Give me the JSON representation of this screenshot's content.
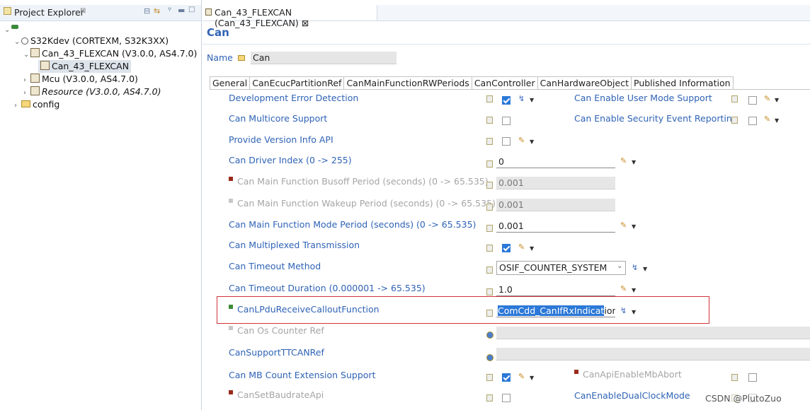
{
  "explorer": {
    "title": "Project Explorer",
    "title_suffix": "⊠",
    "tree": {
      "root": "",
      "project": "S32Kdev (CORTEXM, S32K3XX)",
      "module1": "Can_43_FLEXCAN (V3.0.0, AS4.7.0)",
      "module1_child": "Can_43_FLEXCAN",
      "module2": "Mcu (V3.0.0, AS4.7.0)",
      "module3": "Resource (V3.0.0, AS4.7.0)",
      "folder": "config"
    }
  },
  "editor": {
    "tab_title": "Can_43_FLEXCAN (Can_43_FLEXCAN) ⊠",
    "header": "Can",
    "name_label": "Name",
    "name_value": "Can",
    "tabs": [
      "General",
      "CanEcucPartitionRef",
      "CanMainFunctionRWPeriods",
      "CanController",
      "CanHardwareObject",
      "Published Information"
    ]
  },
  "params": {
    "dev_error": "Development Error Detection",
    "multicore": "Can Multicore Support",
    "version_info": "Provide Version Info API",
    "driver_index": "Can Driver Index (0 -> 255)",
    "driver_index_val": "0",
    "busoff": "Can Main Function Busoff Period (seconds) (0 -> 65.535)",
    "busoff_val": "0.001",
    "wakeup": "Can Main Function Wakeup Period (seconds) (0 -> 65.535)",
    "wakeup_val": "0.001",
    "mode_period": "Can Main Function Mode Period (seconds) (0 -> 65.535)",
    "mode_period_val": "0.001",
    "multiplexed": "Can Multiplexed Transmission",
    "timeout_method": "Can Timeout Method",
    "timeout_method_val": "OSIF_COUNTER_SYSTEM",
    "timeout_duration": "Can Timeout Duration (0.000001 -> 65.535)",
    "timeout_duration_val": "1.0",
    "lpdu_callout": "CanLPduReceiveCalloutFunction",
    "lpdu_callout_val_sel": "ComCdd_CanIfRxIndicat",
    "lpdu_callout_val_rest": "ionH",
    "os_counter": "Can Os Counter Ref",
    "ttcan": "CanSupportTTCANRef",
    "mb_count": "Can MB Count Extension Support",
    "set_baud": "CanSetBaudrateApi",
    "user_mode": "Can Enable User Mode Support",
    "security": "Can Enable Security Event Reporting",
    "mb_abort": "CanApiEnableMbAbort",
    "dual_clock": "CanEnableDualClockMode"
  },
  "watermark": "CSDN @PlutoZuo",
  "colors": {
    "label_blue": "#2f63b5",
    "highlight_border": "#d0343c",
    "selection": "#2b78d8"
  }
}
